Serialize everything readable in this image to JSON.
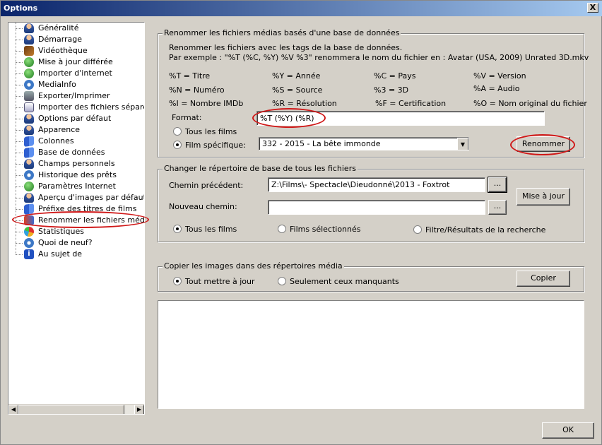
{
  "window": {
    "title": "Options",
    "close_label": "X"
  },
  "tree": {
    "items": [
      {
        "label": "Généralité",
        "icon": "person-icon"
      },
      {
        "label": "Démarrage",
        "icon": "person-icon"
      },
      {
        "label": "Vidéothèque",
        "icon": "film-icon"
      },
      {
        "label": "Mise à jour différée",
        "icon": "globe-icon"
      },
      {
        "label": "Importer d'internet",
        "icon": "globe-icon"
      },
      {
        "label": "MediaInfo",
        "icon": "gear-icon"
      },
      {
        "label": "Exporter/Imprimer",
        "icon": "printer-icon"
      },
      {
        "label": "Importer des fichiers séparés p",
        "icon": "doc-icon"
      },
      {
        "label": "Options par défaut",
        "icon": "person-icon"
      },
      {
        "label": "Apparence",
        "icon": "person-icon"
      },
      {
        "label": "Colonnes",
        "icon": "windows-icon"
      },
      {
        "label": "Base de données",
        "icon": "windows-icon"
      },
      {
        "label": "Champs personnels",
        "icon": "person-icon"
      },
      {
        "label": "Historique des prêts",
        "icon": "gear-icon"
      },
      {
        "label": "Paramètres Internet",
        "icon": "globe-icon"
      },
      {
        "label": "Aperçu d'images par défaut",
        "icon": "person-icon"
      },
      {
        "label": "Préfixe des titres de films",
        "icon": "windows-icon"
      },
      {
        "label": "Renommer les fichiers médias",
        "icon": "flag-icon"
      },
      {
        "label": "Statistiques",
        "icon": "pie-icon"
      },
      {
        "label": "Quoi de neuf?",
        "icon": "gear-icon"
      },
      {
        "label": "Au sujet de",
        "icon": "info-icon"
      }
    ]
  },
  "rename": {
    "title": "Renommer les fichiers médias basés d'une base de données",
    "desc1": "Renommer les fichiers avec les tags de la base de données.",
    "desc2": "Par exemple : \"%T (%C, %Y) %V %3\" renommera le nom du fichier en : Avatar (USA, 2009) Unrated 3D.mkv",
    "tags": [
      [
        "%T = Titre",
        "%Y = Année",
        "%C = Pays",
        "%V = Version"
      ],
      [
        "%N = Numéro",
        "%S = Source",
        "%3 = 3D",
        "%A = Audio"
      ],
      [
        "%I = Nombre IMDb",
        "%R = Résolution",
        "%F = Certification",
        "%O = Nom original du fichier"
      ]
    ],
    "format_label": "Format:",
    "format_value": "%T (%Y) (%R)",
    "radio_all": "Tous les films",
    "radio_specific": "Film spécifique:",
    "specific_value": "332 - 2015 - La bête immonde",
    "rename_button": "Renommer"
  },
  "changedir": {
    "title": "Changer le répertoire de base de tous les fichiers",
    "prev_label": "Chemin précédent:",
    "prev_value": "Z:\\Films\\- Spectacle\\Dieudonné\\2013 - Foxtrot",
    "new_label": "Nouveau chemin:",
    "new_value": "",
    "browse": "...",
    "update_button": "Mise à jour",
    "radio_all": "Tous les films",
    "radio_selected": "Films sélectionnés",
    "radio_filter": "Filtre/Résultats de la recherche"
  },
  "copy": {
    "title": "Copier les images dans des répertoires média",
    "radio_all": "Tout mettre à jour",
    "radio_missing": "Seulement ceux manquants",
    "copy_button": "Copier"
  },
  "ok_button": "OK"
}
